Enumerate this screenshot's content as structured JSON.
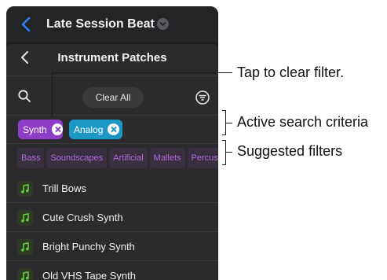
{
  "header": {
    "song_title": "Late Session Beat"
  },
  "sheet": {
    "title": "Instrument Patches",
    "clear_all_label": "Clear All"
  },
  "active_filters": [
    {
      "label": "Synth",
      "color": "#8e3dc7"
    },
    {
      "label": "Analog",
      "color": "#1b97c4"
    }
  ],
  "suggested_filters": [
    "Bass",
    "Soundscapes",
    "Artificial",
    "Mallets",
    "Percussion"
  ],
  "patches": [
    {
      "name": "Trill Bows"
    },
    {
      "name": "Cute Crush Synth"
    },
    {
      "name": "Bright Punchy Synth"
    },
    {
      "name": "Old VHS Tape Synth"
    }
  ],
  "callouts": {
    "tap_clear": "Tap to clear filter.",
    "active_criteria": "Active search criteria",
    "suggested": "Suggested filters"
  },
  "colors": {
    "accent_blue": "#2f7cf6",
    "note_green": "#5fcf3a",
    "suggest_purple": "#b06ae0"
  }
}
